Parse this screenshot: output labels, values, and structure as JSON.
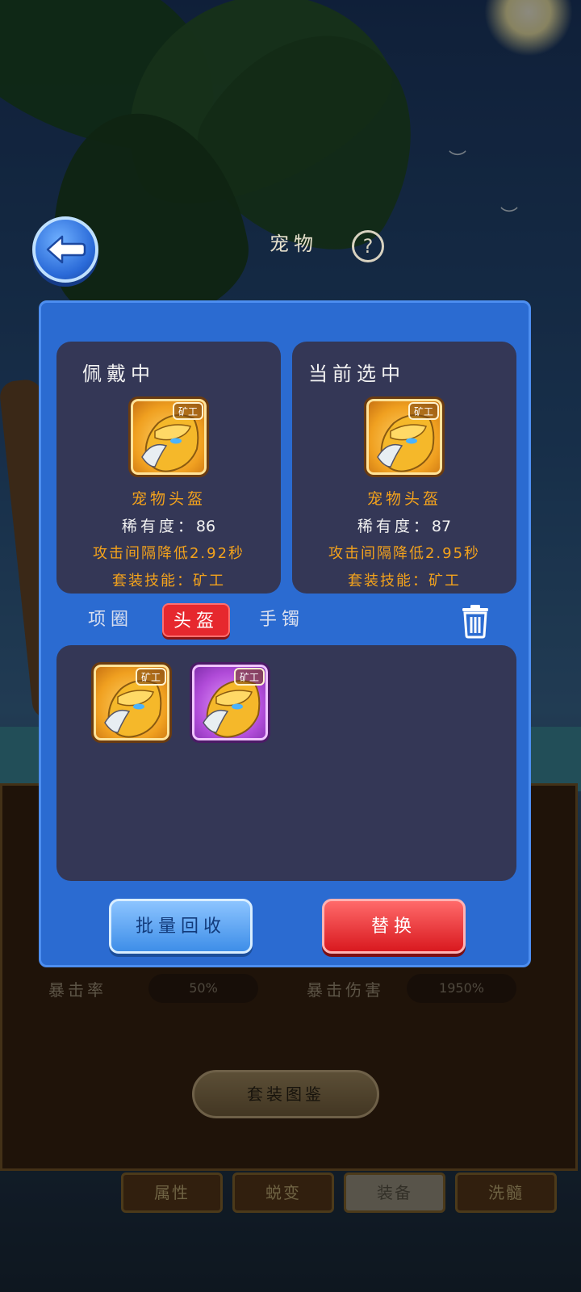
{
  "header": {
    "title": "宠物",
    "help_symbol": "?"
  },
  "background": {
    "stats": [
      {
        "label": "暴击率",
        "value": "50%"
      },
      {
        "label": "暴击伤害",
        "value": "1950%"
      }
    ],
    "set_button_label": "套装图鉴",
    "bottom_tabs": [
      {
        "label": "属性",
        "active": false
      },
      {
        "label": "蜕变",
        "active": false
      },
      {
        "label": "装备",
        "active": true
      },
      {
        "label": "洗髓",
        "active": false
      }
    ]
  },
  "dialog": {
    "equipped": {
      "title": "佩戴中",
      "tag": "矿工",
      "name": "宠物头盔",
      "rarity_label": "稀有度：",
      "rarity_value": "86",
      "effect": "攻击间隔降低2.92秒",
      "set_skill": "套装技能：矿工"
    },
    "selected": {
      "title": "当前选中",
      "tag": "矿工",
      "name": "宠物头盔",
      "rarity_label": "稀有度：",
      "rarity_value": "87",
      "effect": "攻击间隔降低2.95秒",
      "set_skill": "套装技能：矿工"
    },
    "slot_tabs": [
      {
        "label": "项圈",
        "active": false
      },
      {
        "label": "头盔",
        "active": true
      },
      {
        "label": "手镯",
        "active": false
      }
    ],
    "inventory": [
      {
        "tag": "矿工",
        "rarity_color": "gold",
        "selected": true
      },
      {
        "tag": "矿工",
        "rarity_color": "purple",
        "selected": false
      }
    ],
    "buttons": {
      "recycle": "批量回收",
      "replace": "替换"
    }
  },
  "colors": {
    "dialog_blue": "#2b6bd1",
    "card_navy": "#343756",
    "accent_orange": "#f3a21c",
    "active_red": "#e6282e"
  }
}
